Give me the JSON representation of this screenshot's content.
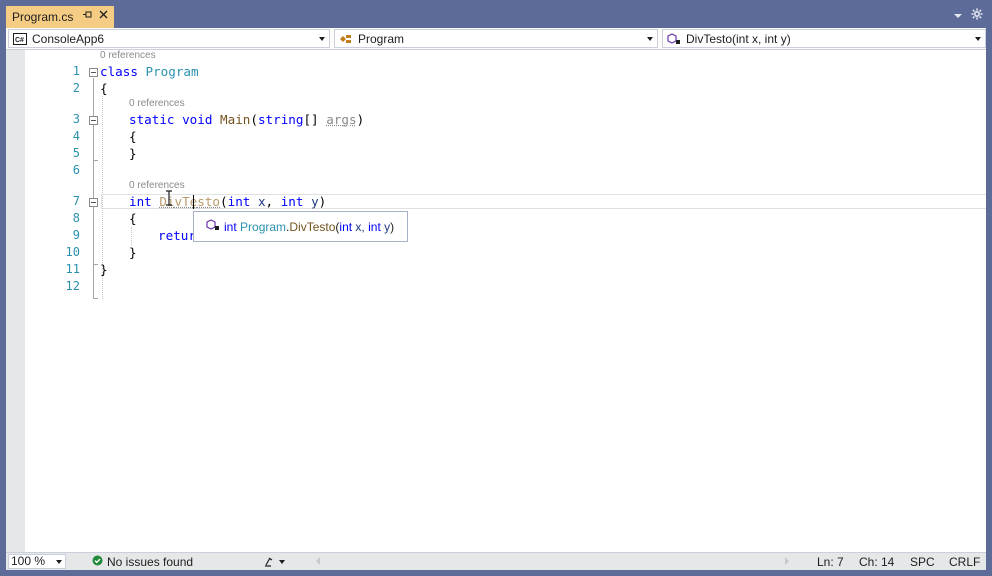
{
  "tab": {
    "title": "Program.cs",
    "pin_glyph": "⊸",
    "close_glyph": "✕"
  },
  "navbar": {
    "project": "ConsoleApp6",
    "class": "Program",
    "member": "DivTesto(int x, int y)"
  },
  "code": {
    "line_numbers": [
      "1",
      "2",
      "3",
      "4",
      "5",
      "6",
      "7",
      "8",
      "9",
      "10",
      "11",
      "12"
    ],
    "references": [
      "0 references",
      "0 references",
      "0 references"
    ],
    "lines": {
      "l1": {
        "kw": "class",
        "type": "Program"
      },
      "l2": {
        "text": "{"
      },
      "l3": {
        "kw1": "static",
        "kw2": "void",
        "method": "Main",
        "open": "(",
        "kw3": "string",
        "arr": "[]",
        "param": "args",
        "close": ")"
      },
      "l4": {
        "text": "{"
      },
      "l5": {
        "text": "}"
      },
      "l7": {
        "kw": "int",
        "method_a": "Di",
        "method_b": "vTe",
        "method_c": "sto",
        "open": "(",
        "kw2": "int",
        "p1": "x",
        "comma": ", ",
        "kw3": "int",
        "p2": "y",
        "close": ")"
      },
      "l8": {
        "text": "{"
      },
      "l9": {
        "kw": "retur"
      },
      "l10": {
        "text": "}"
      },
      "l11": {
        "text": "}"
      }
    }
  },
  "quickinfo": {
    "icon": "method-icon",
    "return_type": "int",
    "class_name": "Program",
    "separator": ".",
    "method_name": "DivTesto",
    "open": "(",
    "kw1": "int",
    "p1": " x, ",
    "kw2": "int",
    "p2": " y",
    "close": ")"
  },
  "statusbar": {
    "zoom": "100 %",
    "issues": "No issues found",
    "line": "Ln: 7",
    "col": "Ch: 14",
    "spacing": "SPC",
    "line_ending": "CRLF"
  },
  "colors": {
    "chrome": "#5d6b99",
    "active_tab": "#f5cc84",
    "keyword": "#0000ff",
    "type": "#2b91af",
    "method": "#74531f",
    "param": "#1f377f"
  }
}
